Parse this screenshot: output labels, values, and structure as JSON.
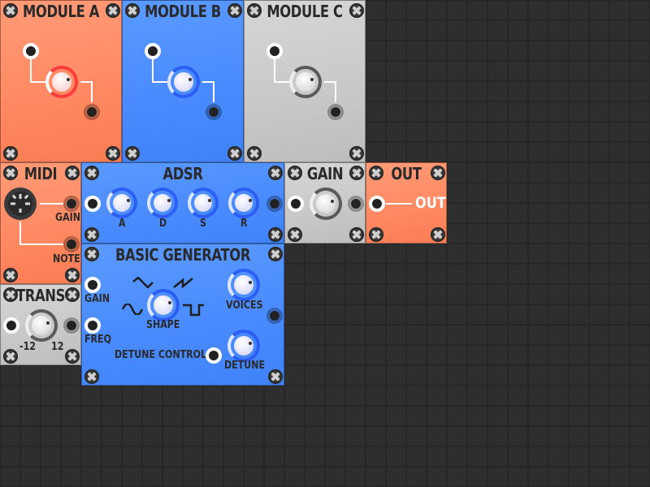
{
  "modules": {
    "module_a": {
      "title": "MODULE A"
    },
    "module_b": {
      "title": "MODULE B"
    },
    "module_c": {
      "title": "MODULE C"
    },
    "midi": {
      "title": "MIDI",
      "gain_label": "GAIN",
      "note_label": "NOTE"
    },
    "adsr": {
      "title": "ADSR",
      "knobs": [
        "A",
        "D",
        "S",
        "R"
      ]
    },
    "gain": {
      "title": "GAIN"
    },
    "out": {
      "title": "OUT",
      "out_label": "OUT"
    },
    "trans": {
      "title": "TRANS",
      "min_label": "-12",
      "max_label": "12"
    },
    "basic_generator": {
      "title": "BASIC GENERATOR",
      "gain_label": "GAIN",
      "freq_label": "FREQ",
      "shape_label": "SHAPE",
      "voices_label": "VOICES",
      "detune_control_label": "DETUNE CONTROL",
      "detune_label": "DETUNE"
    }
  },
  "colors": {
    "orange_panel": "#ff8a63",
    "blue_panel": "#4a8cff",
    "gray_panel": "#c9c9c9",
    "background": "#2e2e2e",
    "knob_ring_red": "#ff3b3b",
    "knob_ring_blue": "#2c5df5"
  }
}
